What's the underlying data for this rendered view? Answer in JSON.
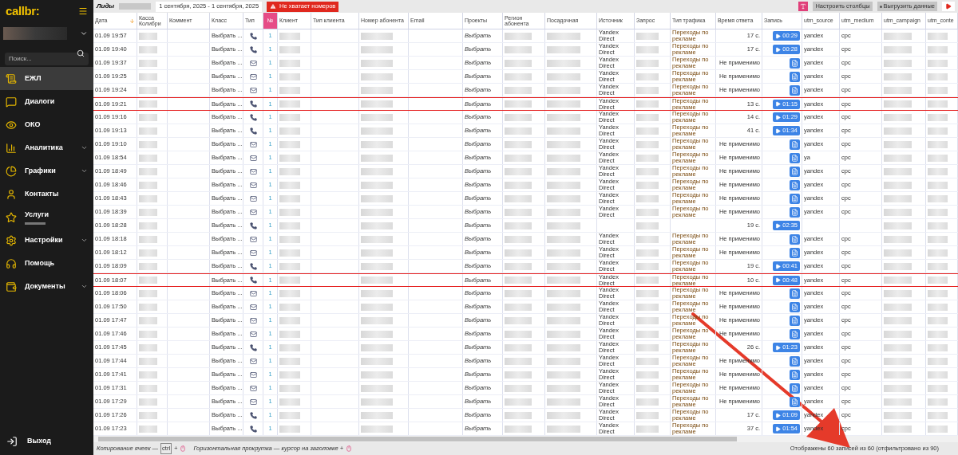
{
  "sidebar": {
    "logo": "callbr:",
    "search": {
      "placeholder": "Поиск..."
    },
    "items": [
      {
        "label": "ЕЖЛ",
        "selected": true,
        "expandable": false,
        "note_blurred": false
      },
      {
        "label": "Диалоги",
        "selected": false,
        "expandable": false,
        "note_blurred": false
      },
      {
        "label": "ОКО",
        "selected": false,
        "expandable": false,
        "note_blurred": false
      },
      {
        "label": "Аналитика",
        "selected": false,
        "expandable": true,
        "note_blurred": false
      },
      {
        "label": "Графики",
        "selected": false,
        "expandable": true,
        "note_blurred": false
      },
      {
        "label": "Контакты",
        "selected": false,
        "expandable": false,
        "note_blurred": false
      },
      {
        "label": "Услуги",
        "selected": false,
        "expandable": false,
        "note_blurred": true
      },
      {
        "label": "Настройки",
        "selected": false,
        "expandable": true,
        "note_blurred": false
      },
      {
        "label": "Помощь",
        "selected": false,
        "expandable": false,
        "note_blurred": false
      },
      {
        "label": "Документы",
        "selected": false,
        "expandable": true,
        "note_blurred": false
      }
    ],
    "logout": "Выход"
  },
  "toolbar": {
    "title": "Лиды",
    "date_range": "1 сентября, 2025 - 1 сентября, 2025",
    "warning_button": "Не хватает номеров",
    "configure_button": "Настроить столбцы",
    "export_button": "Выгрузить данные"
  },
  "table": {
    "columns": [
      {
        "label": "Дата",
        "kind": "time",
        "sorted": true,
        "highlighted": false
      },
      {
        "label": "Касса Колибри",
        "kind": "blurred",
        "sorted": false,
        "highlighted": false
      },
      {
        "label": "Коммент",
        "kind": "empty",
        "sorted": false,
        "highlighted": false
      },
      {
        "label": "Класс",
        "kind": "class",
        "sorted": false,
        "highlighted": false
      },
      {
        "label": "Тип",
        "kind": "type",
        "sorted": false,
        "highlighted": false
      },
      {
        "label": "№",
        "kind": "number",
        "sorted": false,
        "highlighted": true
      },
      {
        "label": "Клиент",
        "kind": "blurred",
        "sorted": false,
        "highlighted": false
      },
      {
        "label": "Тип клиента",
        "kind": "empty",
        "sorted": false,
        "highlighted": false
      },
      {
        "label": "Номер абонента",
        "kind": "blurred",
        "sorted": false,
        "highlighted": false
      },
      {
        "label": "Email",
        "kind": "empty",
        "sorted": false,
        "highlighted": false
      },
      {
        "label": "Проекты",
        "kind": "project",
        "sorted": false,
        "highlighted": false
      },
      {
        "label": "Регион абонента",
        "kind": "blurred",
        "sorted": false,
        "highlighted": false
      },
      {
        "label": "Посадочная",
        "kind": "blurred",
        "sorted": false,
        "highlighted": false
      },
      {
        "label": "Источник",
        "kind": "source",
        "sorted": false,
        "highlighted": false
      },
      {
        "label": "Запрос",
        "kind": "blurred",
        "sorted": false,
        "highlighted": false
      },
      {
        "label": "Тип трафика",
        "kind": "traffic",
        "sorted": false,
        "highlighted": false
      },
      {
        "label": "Время ответа",
        "kind": "answer",
        "sorted": false,
        "highlighted": false
      },
      {
        "label": "Запись",
        "kind": "record",
        "sorted": false,
        "highlighted": false
      },
      {
        "label": "utm_source",
        "kind": "utm_source",
        "sorted": false,
        "highlighted": false
      },
      {
        "label": "utm_medium",
        "kind": "utm_medium",
        "sorted": false,
        "highlighted": false
      },
      {
        "label": "utm_campaign",
        "kind": "blurred",
        "sorted": false,
        "highlighted": false
      },
      {
        "label": "utm_conte",
        "kind": "blurred",
        "sorted": false,
        "highlighted": false
      }
    ],
    "rows": [
      {
        "time": "01.09 19:57",
        "kind": "call",
        "number": "1",
        "class": "Выбрать ...",
        "project": "Выбрать",
        "source": "Yandex Direct",
        "traffic": "Переходы по рекламе",
        "answer": "17 с.",
        "record": {
          "kind": "audio",
          "label": "00:29"
        },
        "utm_source": "yandex",
        "utm_medium": "cpc",
        "flagged": false
      },
      {
        "time": "01.09 19:40",
        "kind": "call",
        "number": "1",
        "class": "Выбрать ...",
        "project": "Выбрать",
        "source": "Yandex Direct",
        "traffic": "Переходы по рекламе",
        "answer": "17 с.",
        "record": {
          "kind": "audio",
          "label": "00:28"
        },
        "utm_source": "yandex",
        "utm_medium": "cpc",
        "flagged": false
      },
      {
        "time": "01.09 19:37",
        "kind": "email",
        "number": "1",
        "class": "Выбрать ...",
        "project": "Выбрать",
        "source": "Yandex Direct",
        "traffic": "Переходы по рекламе",
        "answer": "Не применимо",
        "record": {
          "kind": "document"
        },
        "utm_source": "yandex",
        "utm_medium": "cpc",
        "flagged": false
      },
      {
        "time": "01.09 19:25",
        "kind": "email",
        "number": "1",
        "class": "Выбрать ...",
        "project": "Выбрать",
        "source": "Yandex Direct",
        "traffic": "Переходы по рекламе",
        "answer": "Не применимо",
        "record": {
          "kind": "document"
        },
        "utm_source": "yandex",
        "utm_medium": "cpc",
        "flagged": false
      },
      {
        "time": "01.09 19:24",
        "kind": "email",
        "number": "1",
        "class": "Выбрать ...",
        "project": "Выбрать",
        "source": "Yandex Direct",
        "traffic": "Переходы по рекламе",
        "answer": "Не применимо",
        "record": {
          "kind": "document"
        },
        "utm_source": "yandex",
        "utm_medium": "cpc",
        "flagged": false
      },
      {
        "time": "01.09 19:21",
        "kind": "call",
        "number": "1",
        "class": "Выбрать ...",
        "project": "Выбрать",
        "source": "Yandex Direct",
        "traffic": "Переходы по рекламе",
        "answer": "13 с.",
        "record": {
          "kind": "audio",
          "label": "01:15"
        },
        "utm_source": "yandex",
        "utm_medium": "cpc",
        "flagged": true
      },
      {
        "time": "01.09 19:16",
        "kind": "call",
        "number": "1",
        "class": "Выбрать ...",
        "project": "Выбрать",
        "source": "Yandex Direct",
        "traffic": "Переходы по рекламе",
        "answer": "14 с.",
        "record": {
          "kind": "audio",
          "label": "01:29"
        },
        "utm_source": "yandex",
        "utm_medium": "cpc",
        "flagged": false
      },
      {
        "time": "01.09 19:13",
        "kind": "call",
        "number": "1",
        "class": "Выбрать ...",
        "project": "Выбрать",
        "source": "Yandex Direct",
        "traffic": "Переходы по рекламе",
        "answer": "41 с.",
        "record": {
          "kind": "audio",
          "label": "01:34"
        },
        "utm_source": "yandex",
        "utm_medium": "cpc",
        "flagged": false
      },
      {
        "time": "01.09 19:10",
        "kind": "email",
        "number": "1",
        "class": "Выбрать ...",
        "project": "Выбрать",
        "source": "Yandex Direct",
        "traffic": "Переходы по рекламе",
        "answer": "Не применимо",
        "record": {
          "kind": "document"
        },
        "utm_source": "yandex",
        "utm_medium": "cpc",
        "flagged": false
      },
      {
        "time": "01.09 18:54",
        "kind": "email",
        "number": "1",
        "class": "Выбрать ...",
        "project": "Выбрать",
        "source": "Yandex Direct",
        "traffic": "Переходы по рекламе",
        "answer": "Не применимо",
        "record": {
          "kind": "document"
        },
        "utm_source": "ya",
        "utm_medium": "cpc",
        "flagged": false
      },
      {
        "time": "01.09 18:49",
        "kind": "email",
        "number": "1",
        "class": "Выбрать ...",
        "project": "Выбрать",
        "source": "Yandex Direct",
        "traffic": "Переходы по рекламе",
        "answer": "Не применимо",
        "record": {
          "kind": "document"
        },
        "utm_source": "yandex",
        "utm_medium": "cpc",
        "flagged": false
      },
      {
        "time": "01.09 18:46",
        "kind": "email",
        "number": "1",
        "class": "Выбрать ...",
        "project": "Выбрать",
        "source": "Yandex Direct",
        "traffic": "Переходы по рекламе",
        "answer": "Не применимо",
        "record": {
          "kind": "document"
        },
        "utm_source": "yandex",
        "utm_medium": "cpc",
        "flagged": false
      },
      {
        "time": "01.09 18:43",
        "kind": "email",
        "number": "1",
        "class": "Выбрать ...",
        "project": "Выбрать",
        "source": "Yandex Direct",
        "traffic": "Переходы по рекламе",
        "answer": "Не применимо",
        "record": {
          "kind": "document"
        },
        "utm_source": "yandex",
        "utm_medium": "cpc",
        "flagged": false
      },
      {
        "time": "01.09 18:39",
        "kind": "email",
        "number": "1",
        "class": "Выбрать ...",
        "project": "Выбрать",
        "source": "Yandex Direct",
        "traffic": "Переходы по рекламе",
        "answer": "Не применимо",
        "record": {
          "kind": "document"
        },
        "utm_source": "yandex",
        "utm_medium": "cpc",
        "flagged": false
      },
      {
        "time": "01.09 18:28",
        "kind": "call",
        "number": "1",
        "class": "Выбрать ...",
        "project": "Выбрать",
        "answer": "19 с.",
        "record": {
          "kind": "audio",
          "label": "02:35"
        },
        "flagged": false
      },
      {
        "time": "01.09 18:18",
        "kind": "email",
        "number": "1",
        "class": "Выбрать ...",
        "project": "Выбрать",
        "source": "Yandex Direct",
        "traffic": "Переходы по рекламе",
        "answer": "Не применимо",
        "record": {
          "kind": "document"
        },
        "utm_source": "yandex",
        "utm_medium": "cpc",
        "flagged": false
      },
      {
        "time": "01.09 18:12",
        "kind": "email",
        "number": "1",
        "class": "Выбрать ...",
        "project": "Выбрать",
        "source": "Yandex Direct",
        "traffic": "Переходы по рекламе",
        "answer": "Не применимо",
        "record": {
          "kind": "document"
        },
        "utm_source": "yandex",
        "utm_medium": "cpc",
        "flagged": false
      },
      {
        "time": "01.09 18:09",
        "kind": "call",
        "number": "1",
        "class": "Выбрать ...",
        "project": "Выбрать",
        "source": "Yandex Direct",
        "traffic": "Переходы по рекламе",
        "answer": "19 с.",
        "record": {
          "kind": "audio",
          "label": "00:41"
        },
        "utm_source": "yandex",
        "utm_medium": "cpc",
        "flagged": false
      },
      {
        "time": "01.09 18:07",
        "kind": "call",
        "number": "1",
        "class": "Выбрать ...",
        "project": "Выбрать",
        "source": "Yandex Direct",
        "traffic": "Переходы по рекламе",
        "answer": "10 с.",
        "record": {
          "kind": "audio",
          "label": "00:48"
        },
        "utm_source": "yandex",
        "utm_medium": "cpc",
        "flagged": true
      },
      {
        "time": "01.09 18:06",
        "kind": "email",
        "number": "1",
        "class": "Выбрать ...",
        "project": "Выбрать",
        "source": "Yandex Direct",
        "traffic": "Переходы по рекламе",
        "answer": "Не применимо",
        "record": {
          "kind": "document"
        },
        "utm_source": "yandex",
        "utm_medium": "cpc",
        "flagged": false
      },
      {
        "time": "01.09 17:50",
        "kind": "email",
        "number": "1",
        "class": "Выбрать ...",
        "project": "Выбрать",
        "source": "Yandex Direct",
        "traffic": "Переходы по рекламе",
        "answer": "Не применимо",
        "record": {
          "kind": "document"
        },
        "utm_source": "yandex",
        "utm_medium": "cpc",
        "flagged": false
      },
      {
        "time": "01.09 17:47",
        "kind": "email",
        "number": "1",
        "class": "Выбрать ...",
        "project": "Выбрать",
        "source": "Yandex Direct",
        "traffic": "Переходы по рекламе",
        "answer": "Не применимо",
        "record": {
          "kind": "document"
        },
        "utm_source": "yandex",
        "utm_medium": "cpc",
        "flagged": false
      },
      {
        "time": "01.09 17:46",
        "kind": "email",
        "number": "1",
        "class": "Выбрать ...",
        "project": "Выбрать",
        "source": "Yandex Direct",
        "traffic": "Переходы по рекламе",
        "answer": "Не применимо",
        "record": {
          "kind": "document"
        },
        "utm_source": "yandex",
        "utm_medium": "cpc",
        "flagged": false
      },
      {
        "time": "01.09 17:45",
        "kind": "call",
        "number": "1",
        "class": "Выбрать ...",
        "project": "Выбрать",
        "source": "Yandex Direct",
        "traffic": "Переходы по рекламе",
        "answer": "26 с.",
        "record": {
          "kind": "audio",
          "label": "01:23"
        },
        "utm_source": "yandex",
        "utm_medium": "cpc",
        "flagged": false
      },
      {
        "time": "01.09 17:44",
        "kind": "email",
        "number": "1",
        "class": "Выбрать ...",
        "project": "Выбрать",
        "source": "Yandex Direct",
        "traffic": "Переходы по рекламе",
        "answer": "Не применимо",
        "record": {
          "kind": "document"
        },
        "utm_source": "yandex",
        "utm_medium": "cpc",
        "flagged": false
      },
      {
        "time": "01.09 17:41",
        "kind": "email",
        "number": "1",
        "class": "Выбрать ...",
        "project": "Выбрать",
        "source": "Yandex Direct",
        "traffic": "Переходы по рекламе",
        "answer": "Не применимо",
        "record": {
          "kind": "document"
        },
        "utm_source": "yandex",
        "utm_medium": "cpc",
        "flagged": false
      },
      {
        "time": "01.09 17:31",
        "kind": "email",
        "number": "1",
        "class": "Выбрать ...",
        "project": "Выбрать",
        "source": "Yandex Direct",
        "traffic": "Переходы по рекламе",
        "answer": "Не применимо",
        "record": {
          "kind": "document"
        },
        "utm_source": "yandex",
        "utm_medium": "cpc",
        "flagged": false
      },
      {
        "time": "01.09 17:29",
        "kind": "email",
        "number": "1",
        "class": "Выбрать ...",
        "project": "Выбрать",
        "source": "Yandex Direct",
        "traffic": "Переходы по рекламе",
        "answer": "Не применимо",
        "record": {
          "kind": "document"
        },
        "utm_source": "yandex",
        "utm_medium": "cpc",
        "flagged": false
      },
      {
        "time": "01.09 17:26",
        "kind": "call",
        "number": "1",
        "class": "Выбрать ...",
        "project": "Выбрать",
        "source": "Yandex Direct",
        "traffic": "Переходы по рекламе",
        "answer": "17 с.",
        "record": {
          "kind": "audio",
          "label": "01:09"
        },
        "utm_source": "yandex",
        "utm_medium": "cpc",
        "flagged": false
      },
      {
        "time": "01.09 17:23",
        "kind": "call",
        "number": "1",
        "class": "Выбрать ...",
        "project": "Выбрать",
        "source": "Yandex Direct",
        "traffic": "Переходы по рекламе",
        "answer": "37 с.",
        "record": {
          "kind": "audio",
          "label": "01:54"
        },
        "utm_source": "yandex",
        "utm_medium": "cpc",
        "flagged": false
      }
    ]
  },
  "footer": {
    "copy_hint": "Копирование ячеек —",
    "key": "ctrl",
    "plus": "+",
    "scroll_hint": "Горизонтальная прокрутка — курсор на заголовке +",
    "summary": "Отображены 60 записей из 60 (отфильтровано из 90)"
  }
}
